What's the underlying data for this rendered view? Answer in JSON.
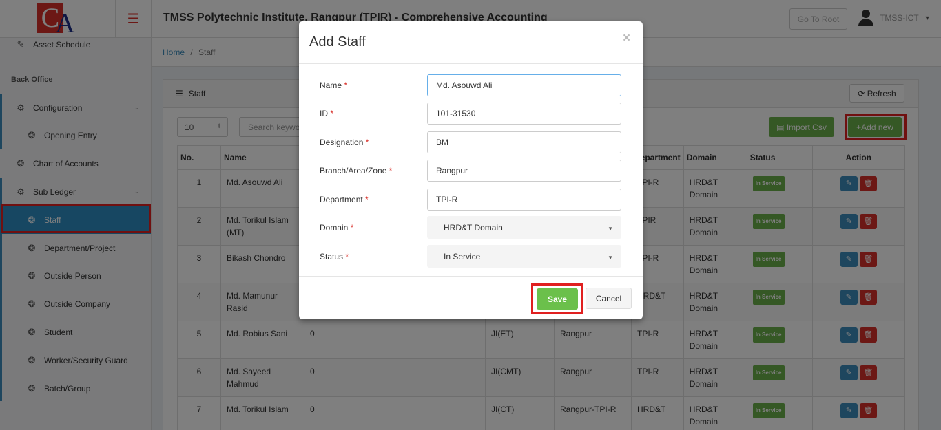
{
  "header": {
    "app_title": "TMSS Polytechnic Institute, Rangpur (TPIR) - Comprehensive Accounting",
    "goto_root_label": "Go To Root",
    "user_name": "TMSS-ICT",
    "logo_letters": [
      "C",
      "A"
    ]
  },
  "sidebar": {
    "asset_schedule": "Asset Schedule",
    "section_back_office": "Back Office",
    "configuration": "Configuration",
    "opening_entry": "Opening Entry",
    "chart_of_accounts": "Chart of Accounts",
    "sub_ledger": "Sub Ledger",
    "staff": "Staff",
    "department_project": "Department/Project",
    "outside_person": "Outside Person",
    "outside_company": "Outside Company",
    "student": "Student",
    "worker_security_guard": "Worker/Security Guard",
    "batch_group": "Batch/Group"
  },
  "breadcrumb": {
    "home": "Home",
    "separator": "/",
    "current": "Staff"
  },
  "panel": {
    "title": "Staff",
    "refresh_label": "Refresh",
    "page_size": "10",
    "search_placeholder": "Search keyword",
    "import_label": "Import Csv",
    "add_label": "Add new"
  },
  "table": {
    "columns": [
      "No.",
      "Name",
      "Department",
      "Domain",
      "Status",
      "Action"
    ],
    "rows": [
      {
        "no": "1",
        "name": "Md. Asouwd Ali",
        "col3": "",
        "col4": "",
        "col5": "",
        "dept": "TPI-R",
        "domain": "HRD&T Domain",
        "status": "In Service"
      },
      {
        "no": "2",
        "name": "Md. Torikul Islam (MT)",
        "col3": "",
        "col4": "",
        "col5": "",
        "dept": "TPIR",
        "domain": "HRD&T Domain",
        "status": "In Service"
      },
      {
        "no": "3",
        "name": "Bikash Chondro",
        "col3": "",
        "col4": "",
        "col5": "",
        "dept": "TPI-R",
        "domain": "HRD&T Domain",
        "status": "In Service"
      },
      {
        "no": "4",
        "name": "Md. Mamunur Rasid",
        "col3": "",
        "col4": "",
        "col5": "",
        "dept": "HRD&T",
        "domain": "HRD&T Domain",
        "status": "In Service"
      },
      {
        "no": "5",
        "name": "Md. Robius Sani",
        "col3": "0",
        "col4": "JI(ET)",
        "col5": "Rangpur",
        "dept": "TPI-R",
        "domain": "HRD&T Domain",
        "status": "In Service"
      },
      {
        "no": "6",
        "name": "Md. Sayeed Mahmud",
        "col3": "0",
        "col4": "JI(CMT)",
        "col5": "Rangpur",
        "dept": "TPI-R",
        "domain": "HRD&T Domain",
        "status": "In Service"
      },
      {
        "no": "7",
        "name": "Md. Torikul Islam",
        "col3": "0",
        "col4": "JI(CT)",
        "col5": "Rangpur-TPI-R",
        "dept": "HRD&T",
        "domain": "HRD&T Domain",
        "status": "In Service"
      }
    ]
  },
  "modal": {
    "title": "Add Staff",
    "close_symbol": "×",
    "required_mark": "*",
    "fields": {
      "name": {
        "label": "Name",
        "value": "Md. Asouwd Ali"
      },
      "id": {
        "label": "ID",
        "value": "101-31530"
      },
      "designation": {
        "label": "Designation",
        "value": "BM"
      },
      "branch": {
        "label": "Branch/Area/Zone",
        "value": "Rangpur"
      },
      "department": {
        "label": "Department",
        "value": "TPI-R"
      },
      "domain": {
        "label": "Domain",
        "value": "HRD&T Domain"
      },
      "status": {
        "label": "Status",
        "value": "In Service"
      }
    },
    "save_label": "Save",
    "cancel_label": "Cancel"
  },
  "colors": {
    "brand_red": "#d9312a",
    "brand_blue": "#1c2e88",
    "active_blue": "#2f8fc5",
    "success_green": "#6bb04a",
    "highlight_red": "#e02020"
  }
}
